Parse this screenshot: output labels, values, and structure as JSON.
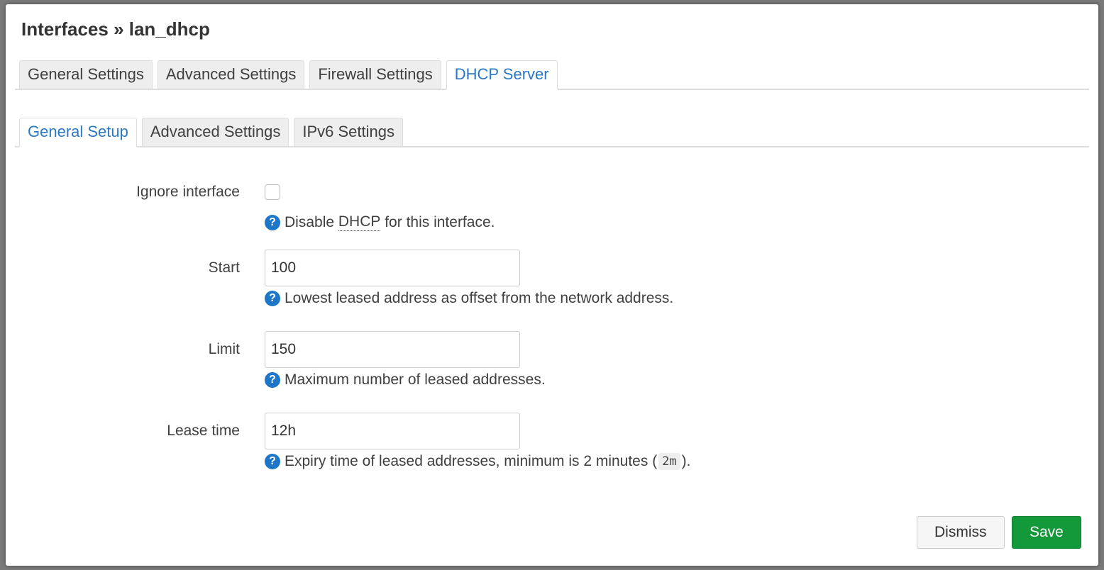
{
  "modal": {
    "title": "Interfaces » lan_dhcp"
  },
  "primary_tabs": [
    {
      "label": "General Settings",
      "active": false
    },
    {
      "label": "Advanced Settings",
      "active": false
    },
    {
      "label": "Firewall Settings",
      "active": false
    },
    {
      "label": "DHCP Server",
      "active": true
    }
  ],
  "secondary_tabs": [
    {
      "label": "General Setup",
      "active": true
    },
    {
      "label": "Advanced Settings",
      "active": false
    },
    {
      "label": "IPv6 Settings",
      "active": false
    }
  ],
  "fields": {
    "ignore": {
      "label": "Ignore interface",
      "checked": false,
      "help_prefix": "Disable ",
      "help_abbr": "DHCP",
      "help_suffix": " for this interface."
    },
    "start": {
      "label": "Start",
      "value": "100",
      "help": "Lowest leased address as offset from the network address."
    },
    "limit": {
      "label": "Limit",
      "value": "150",
      "help": "Maximum number of leased addresses."
    },
    "leasetime": {
      "label": "Lease time",
      "value": "12h",
      "help_prefix": "Expiry time of leased addresses, minimum is 2 minutes (",
      "help_code": "2m",
      "help_suffix": ")."
    }
  },
  "help_icon_glyph": "?",
  "buttons": {
    "dismiss": "Dismiss",
    "save": "Save"
  },
  "colors": {
    "accent": "#2a78c6",
    "help_icon": "#1e76c8",
    "save": "#13983a"
  }
}
